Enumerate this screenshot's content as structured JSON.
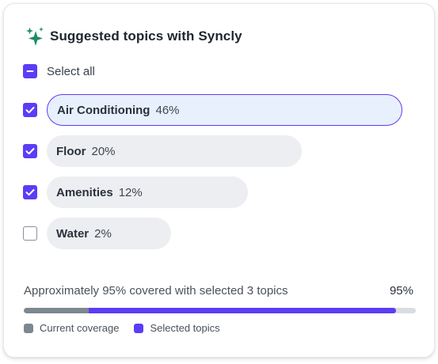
{
  "card": {
    "title": "Suggested topics with Syncly",
    "icon": "sparkle-icon"
  },
  "select_all": {
    "label": "Select all",
    "state": "indeterminate"
  },
  "topics": [
    {
      "name": "Air Conditioning",
      "percent": "46%",
      "checked": true,
      "highlighted": true
    },
    {
      "name": "Floor",
      "percent": "20%",
      "checked": true,
      "highlighted": false
    },
    {
      "name": "Amenities",
      "percent": "12%",
      "checked": true,
      "highlighted": false
    },
    {
      "name": "Water",
      "percent": "2%",
      "checked": false,
      "highlighted": false
    }
  ],
  "coverage": {
    "text": "Approximately 95% covered with selected 3 topics",
    "percent_label": "95%",
    "current_fraction": 0.165,
    "selected_fraction": 0.95
  },
  "legend": {
    "current": "Current coverage",
    "selected": "Selected topics"
  },
  "colors": {
    "accent": "#5b3df5",
    "sparkle": "#1f8a63",
    "current": "#7d8790",
    "track": "#d9dde2"
  }
}
